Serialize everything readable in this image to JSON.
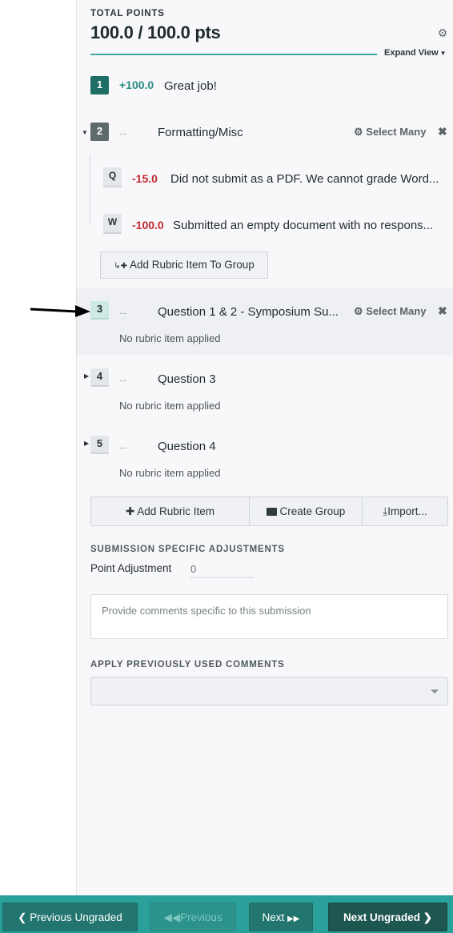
{
  "header": {
    "total_label": "TOTAL POINTS",
    "total_value": "100.0 / 100.0 pts",
    "settings_icon": "gear-icon",
    "expand_view_label": "Expand View",
    "progress_fraction": 1.0
  },
  "rubric": {
    "items": [
      {
        "key": "1",
        "points": "+100.0",
        "description": "Great job!"
      },
      {
        "key": "2",
        "points": "--",
        "title": "Formatting/Misc",
        "select_many": "Select Many",
        "expanded": true,
        "children": [
          {
            "key": "Q",
            "points": "-15.0",
            "description": "Did not submit as a PDF. We cannot grade Word..."
          },
          {
            "key": "W",
            "points": "-100.0",
            "description": "Submitted an empty document with no respons..."
          }
        ],
        "add_to_group_label": "Add Rubric Item To Group"
      },
      {
        "key": "3",
        "points": "--",
        "title": "Question 1 & 2 - Symposium Su...",
        "select_many": "Select Many",
        "status": "No rubric item applied",
        "highlighted": true
      },
      {
        "key": "4",
        "points": "--",
        "title": "Question 3",
        "status": "No rubric item applied"
      },
      {
        "key": "5",
        "points": "--",
        "title": "Question 4",
        "status": "No rubric item applied"
      }
    ]
  },
  "actions": {
    "add_rubric_item": "Add Rubric Item",
    "create_group": "Create Group",
    "import": "Import..."
  },
  "adjustments": {
    "section_label": "SUBMISSION SPECIFIC ADJUSTMENTS",
    "point_adjustment_label": "Point Adjustment",
    "point_adjustment_value": "0",
    "comment_placeholder": "Provide comments specific to this submission"
  },
  "previous_comments": {
    "section_label": "APPLY PREVIOUSLY USED COMMENTS",
    "selected": ""
  },
  "footer": {
    "previous_ungraded": "Previous Ungraded",
    "previous": "Previous",
    "next": "Next",
    "next_ungraded": "Next Ungraded"
  },
  "colors": {
    "accent_teal": "#2aa09a",
    "positive": "#2a8c83",
    "negative": "#c2262e",
    "dark_green": "#1d574f"
  }
}
